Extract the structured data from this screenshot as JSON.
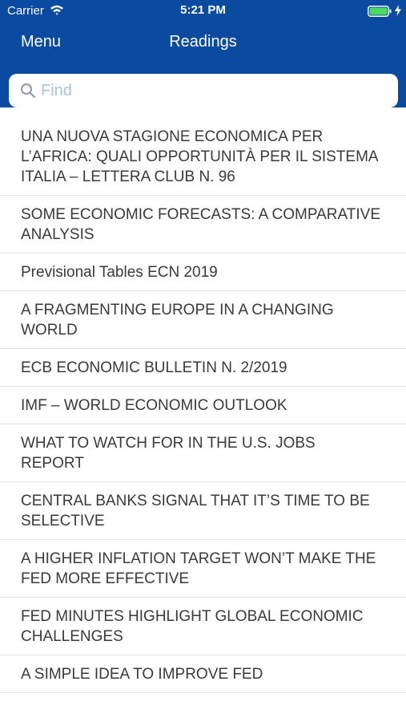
{
  "status_bar": {
    "carrier": "Carrier",
    "time": "5:21 PM",
    "wifi_icon": "wifi-icon",
    "battery_icon": "battery-full-charging-icon",
    "battery_color": "#4cd964"
  },
  "nav": {
    "menu_label": "Menu",
    "title": "Readings",
    "bar_color": "#0a4aa0"
  },
  "search": {
    "placeholder": "Find",
    "value": "",
    "icon": "search-icon"
  },
  "readings": [
    {
      "title": "UNA NUOVA STAGIONE ECONOMICA PER L’AFRICA: QUALI OPPORTUNITÀ PER IL SISTEMA ITALIA – LETTERA CLUB N. 96"
    },
    {
      "title": "SOME ECONOMIC FORECASTS: A COMPARATIVE ANALYSIS"
    },
    {
      "title": "Previsional Tables ECN 2019"
    },
    {
      "title": "A FRAGMENTING EUROPE IN A CHANGING WORLD"
    },
    {
      "title": "ECB ECONOMIC BULLETIN N. 2/2019"
    },
    {
      "title": "IMF – WORLD ECONOMIC OUTLOOK"
    },
    {
      "title": "WHAT TO WATCH FOR IN THE U.S. JOBS REPORT"
    },
    {
      "title": "CENTRAL BANKS SIGNAL THAT IT’S TIME TO BE SELECTIVE"
    },
    {
      "title": "A HIGHER INFLATION TARGET WON’T MAKE THE FED MORE EFFECTIVE"
    },
    {
      "title": "FED MINUTES HIGHLIGHT GLOBAL ECONOMIC CHALLENGES"
    },
    {
      "title": "A SIMPLE IDEA TO IMPROVE FED"
    }
  ]
}
